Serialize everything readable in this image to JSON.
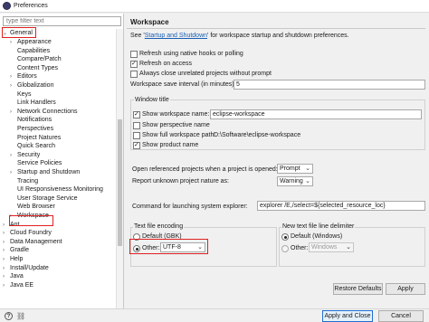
{
  "window": {
    "title": "Preferences"
  },
  "filter": {
    "placeholder": "type filter text"
  },
  "tree": {
    "general": "General",
    "general_children": [
      "Appearance",
      "Capabilities",
      "Compare/Patch",
      "Content Types",
      "Editors",
      "Globalization",
      "Keys",
      "Link Handlers",
      "Network Connections",
      "Notifications",
      "Perspectives",
      "Project Natures",
      "Quick Search",
      "Security",
      "Service Policies",
      "Startup and Shutdown",
      "Tracing",
      "UI Responsiveness Monitoring",
      "User Storage Service",
      "Web Browser",
      "Workspace"
    ],
    "top_level": [
      "Ant",
      "Cloud Foundry",
      "Data Management",
      "Gradle",
      "Help",
      "Install/Update",
      "Java",
      "Java EE"
    ]
  },
  "workspace": {
    "title": "Workspace",
    "see_prefix": "See '",
    "see_link": "Startup and Shutdown",
    "see_suffix": "' for workspace startup and shutdown preferences.",
    "refresh_native": "Refresh using native hooks or polling",
    "refresh_access": "Refresh on access",
    "always_close": "Always close unrelated projects without prompt",
    "save_interval_label": "Workspace save interval (in minutes):",
    "save_interval_value": "5",
    "window_title_group": "Window title",
    "show_ws_name": "Show workspace name:",
    "ws_name_value": "eclipse-workspace",
    "show_perspective": "Show perspective name",
    "show_full_path": "Show full workspace path:",
    "full_path_value": "D:\\Software\\eclipse-workspace",
    "show_product": "Show product name",
    "open_ref_label": "Open referenced projects when a project is opened:",
    "open_ref_value": "Prompt",
    "report_nature_label": "Report unknown project nature as:",
    "report_nature_value": "Warning",
    "cmd_label": "Command for launching system explorer:",
    "cmd_value": "explorer /E,/select=${selected_resource_loc}",
    "encoding_group": "Text file encoding",
    "default_gbk": "Default (GBK)",
    "other": "Other:",
    "encoding_value": "UTF-8",
    "delimiter_group": "New text file line delimiter",
    "default_windows": "Default (Windows)",
    "other_delim": "Other:",
    "delim_value": "Windows",
    "restore_defaults": "Restore Defaults",
    "apply": "Apply",
    "apply_close": "Apply and Close",
    "cancel": "Cancel"
  },
  "colors": {
    "highlight": "#e02020",
    "link": "#1a5fb4"
  },
  "icons": {
    "help": "help-icon",
    "link": "link-icon",
    "app": "eclipse-icon"
  }
}
